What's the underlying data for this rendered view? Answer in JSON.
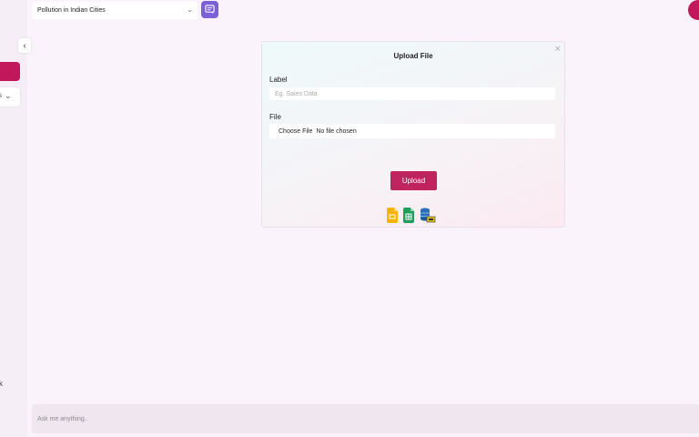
{
  "topbar": {
    "selected_dataset": "Pollution in Indian Cities",
    "chevron_icon": "chevron-down-icon",
    "action_icon": "chat-icon",
    "action_color": "#7b61d6"
  },
  "sidebar": {
    "accent_color": "#c2185b"
  },
  "modal": {
    "title": "Upload File",
    "close_icon": "close-icon",
    "label_field": {
      "label": "Label",
      "placeholder": "Eg. Sales Data"
    },
    "file_field": {
      "label": "File",
      "choose_text": "Choose File",
      "status_text": "No file chosen"
    },
    "upload_label": "Upload",
    "upload_color": "#c0245e",
    "file_type_icons": [
      "slides-file-icon",
      "sheets-file-icon",
      "database-file-icon"
    ]
  },
  "chat": {
    "placeholder": "Ask me anything.."
  }
}
